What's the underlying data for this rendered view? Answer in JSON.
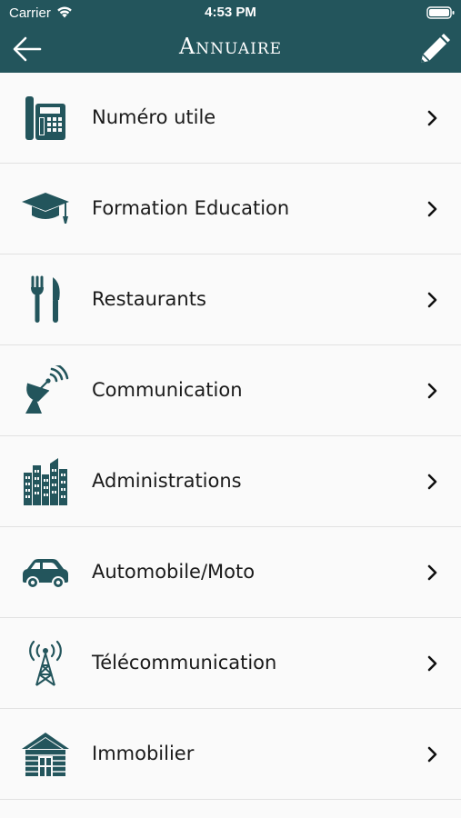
{
  "status_bar": {
    "carrier": "Carrier",
    "time": "4:53 PM"
  },
  "nav": {
    "title": "Annuaire",
    "back_icon": "arrow-left-icon",
    "edit_icon": "pencil-icon"
  },
  "colors": {
    "header_bg": "#23555c",
    "icon_color": "#23555c",
    "background": "#fafafa"
  },
  "items": [
    {
      "label": "Numéro utile",
      "icon": "phone-icon"
    },
    {
      "label": "Formation Education",
      "icon": "graduation-cap-icon"
    },
    {
      "label": "Restaurants",
      "icon": "fork-knife-icon"
    },
    {
      "label": "Communication",
      "icon": "satellite-dish-icon"
    },
    {
      "label": "Administrations",
      "icon": "buildings-icon"
    },
    {
      "label": "Automobile/Moto",
      "icon": "car-icon"
    },
    {
      "label": "Télécommunication",
      "icon": "antenna-tower-icon"
    },
    {
      "label": "Immobilier",
      "icon": "house-icon"
    }
  ]
}
